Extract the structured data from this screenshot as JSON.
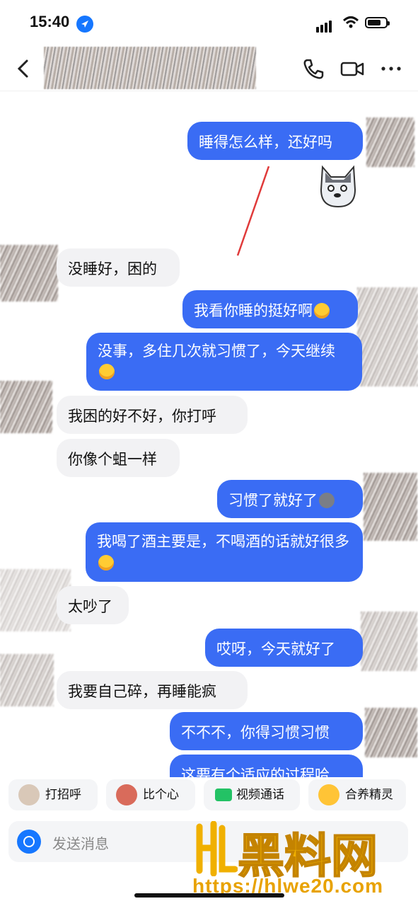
{
  "status_bar": {
    "time": "15:40",
    "battery_level": 0.75
  },
  "header": {
    "contact_name": ""
  },
  "messages": [
    {
      "side": "me",
      "text": "睡得怎么样，还好吗"
    },
    {
      "side": "them",
      "text": "没睡好，困的"
    },
    {
      "side": "me",
      "text": "我看你睡的挺好啊",
      "emoji": "laughing-crying"
    },
    {
      "side": "me",
      "text": "没事，多住几次就习惯了，今天继续",
      "emoji": "laughing-crying"
    },
    {
      "side": "them",
      "text": "我困的好不好，你打呼"
    },
    {
      "side": "them",
      "text": "你像个蛆一样"
    },
    {
      "side": "me",
      "text": "习惯了就好了",
      "emoji": "shiba-dog"
    },
    {
      "side": "me",
      "text": "我喝了酒主要是，不喝酒的话就好很多",
      "emoji": "laughing-crying"
    },
    {
      "side": "them",
      "text": "太吵了"
    },
    {
      "side": "me",
      "text": "哎呀，今天就好了"
    },
    {
      "side": "them",
      "text": "我要自己碎，再睡能疯"
    },
    {
      "side": "me",
      "text": "不不不，你得习惯习惯"
    },
    {
      "side": "me",
      "text": "这要有个适应的过程哈"
    }
  ],
  "quick_actions": [
    {
      "label": "打招呼",
      "icon": "avatar-wave-icon"
    },
    {
      "label": "比个心",
      "icon": "avatar-heart-icon"
    },
    {
      "label": "视频通话",
      "icon": "video-camera-icon"
    },
    {
      "label": "合养精灵",
      "icon": "duck-pet-icon"
    }
  ],
  "input": {
    "placeholder": "发送消息"
  },
  "watermark": {
    "text": "黑料网",
    "url": "https://hlwe20.com"
  },
  "colors": {
    "accent": "#3a6cf4",
    "bubble_other": "#f2f2f4",
    "watermark": "#f0b000"
  }
}
